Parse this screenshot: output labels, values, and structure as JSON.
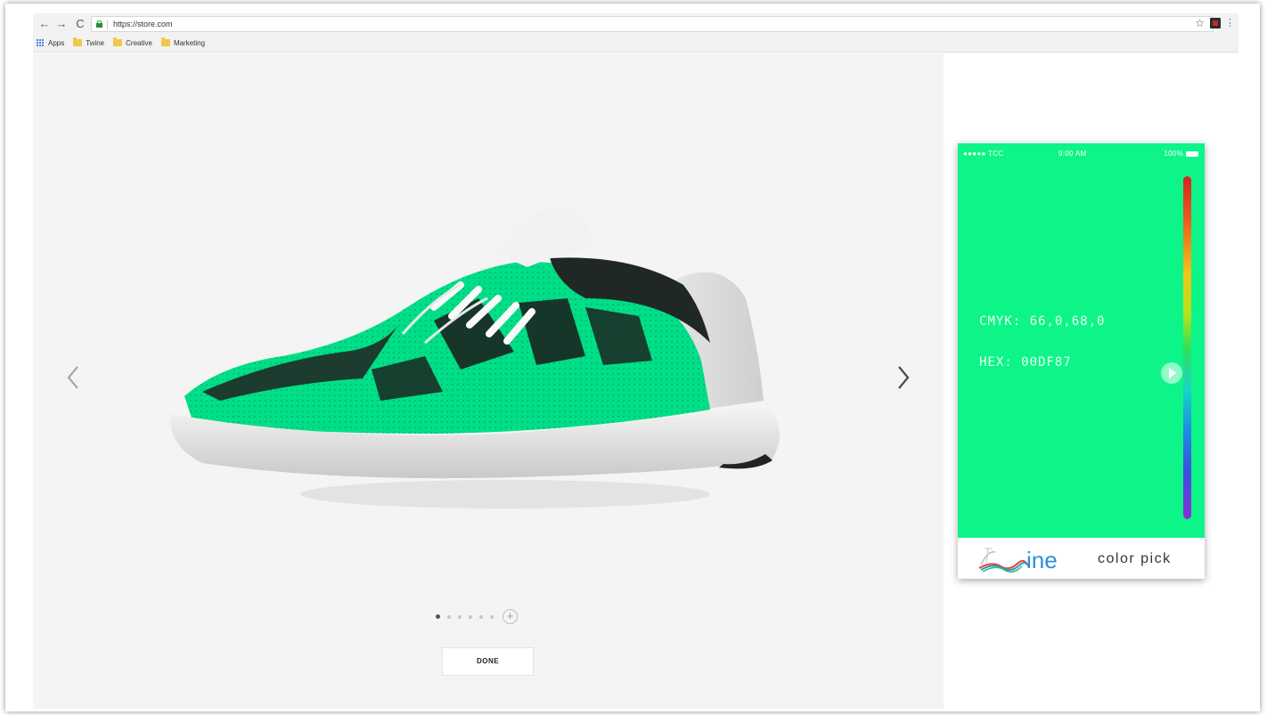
{
  "browser": {
    "url": "https://store.com",
    "bookmarks": [
      {
        "label": "Apps",
        "icon": "apps-grid-icon"
      },
      {
        "label": "Twine",
        "icon": "folder-icon"
      },
      {
        "label": "Creative",
        "icon": "folder-icon"
      },
      {
        "label": "Marketing",
        "icon": "folder-icon"
      }
    ]
  },
  "viewer": {
    "carousel": {
      "count": 6,
      "active_index": 0
    },
    "add_view_symbol": "+",
    "done_label": "DONE",
    "shoe_color": "#00DF87"
  },
  "phone": {
    "status": {
      "carrier": "●●●●● TCC",
      "time": "9:00 AM",
      "battery": "100%"
    },
    "cmyk": "CMYK: 66,0,68,0",
    "hex": "HEX:  00DF87",
    "screen_color": "#0df588",
    "footer": {
      "logo_text": "ine",
      "label": "color pick"
    }
  }
}
